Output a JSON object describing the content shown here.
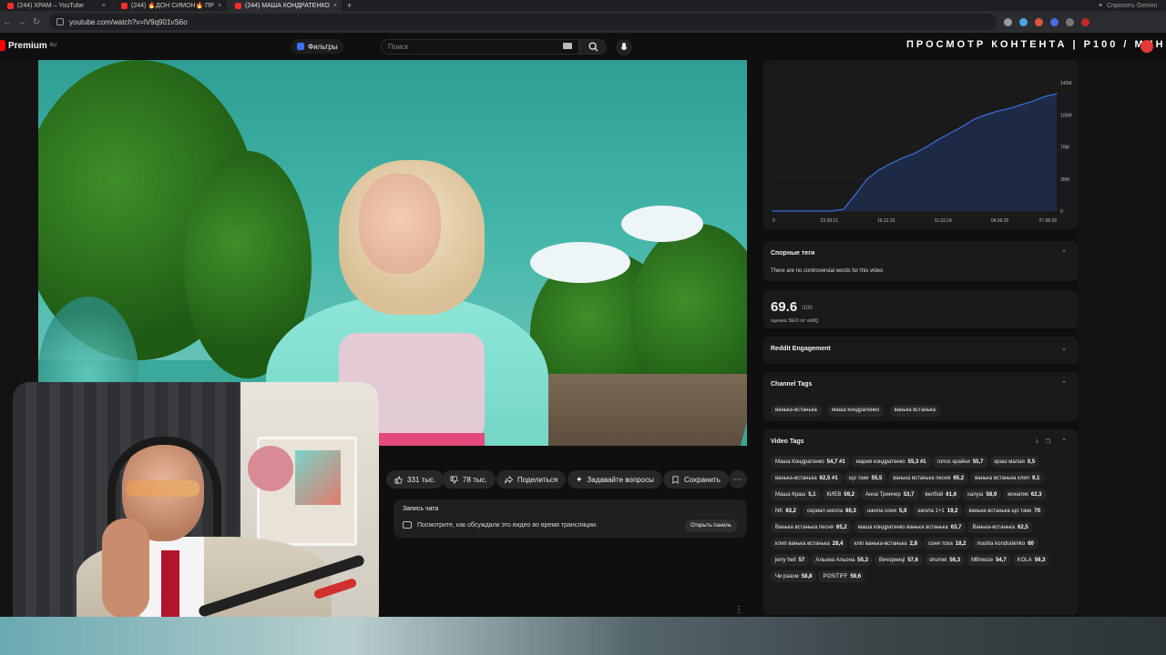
{
  "browser": {
    "tabs": [
      {
        "label": "(244) ХРАМ – YouTube"
      },
      {
        "label": "(244) 🔥ДОН СИМОН🔥 ПР"
      },
      {
        "label": "(244) МАША КОНДРАТЕНКО"
      }
    ],
    "new_tab": "+",
    "gemini": "Спросить Gemini",
    "url": "youtube.com/watch?v=lV9q901vS6o"
  },
  "header": {
    "logo": "Premium",
    "logo_sup": "RU",
    "filters": "Фильтры",
    "search_placeholder": "Поиск",
    "overlay": "ПРОСМОТР КОНТЕНТА | P100 / МИН"
  },
  "actions": {
    "likes": "331 тыс.",
    "dislikes": "78 тыс.",
    "share": "Поделиться",
    "ask": "Задавайте вопросы",
    "save": "Сохранить",
    "more": "⋯"
  },
  "chat": {
    "title": "Запись чата",
    "desc": "Посмотрите, как обсуждали это видео во время трансляции.",
    "open": "Открыть панель"
  },
  "chart_data": {
    "type": "area",
    "x": [
      "23.09.21",
      "16.12.22",
      "11.03.24",
      "04.06.25",
      "27.08.26"
    ],
    "x_ticks_labels": [
      "0",
      "23.09.21",
      "16.12.22",
      "11.03.24",
      "04.06.25",
      "27.08.26"
    ],
    "y_ticks": [
      "0",
      "35M",
      "70M",
      "105M",
      "140M"
    ],
    "ylim": [
      0,
      140
    ],
    "series": [
      {
        "values": [
          0,
          0,
          0,
          0,
          0,
          0,
          2,
          18,
          35,
          45,
          52,
          58,
          63,
          70,
          78,
          85,
          92,
          100,
          105,
          109,
          112,
          116,
          120,
          125,
          128
        ]
      }
    ],
    "color": "#3b6fe0"
  },
  "cards": {
    "controversial_title": "Спорные теги",
    "controversial_note": "There are no controversial words for this video",
    "seo_score": "69.6",
    "seo_max": "/100",
    "seo_label": "оценка SEO от vidIQ",
    "reddit_title": "Reddit Engagement",
    "channel_tags_title": "Channel Tags",
    "channel_tags": [
      "ванька-встанька",
      "маша кондратенко",
      "ванька встанька"
    ],
    "video_tags_title": "Video Tags",
    "video_tags": [
      {
        "name": "Маша Кондратенко",
        "score": "54,7 #1"
      },
      {
        "name": "мария кондратенко",
        "score": "55,3 #1"
      },
      {
        "name": "голос крайни",
        "score": "55,7"
      },
      {
        "name": "краш малая",
        "score": "0,5"
      },
      {
        "name": "ванька-встанька",
        "score": "62,5 #1"
      },
      {
        "name": "що таке",
        "score": "55,5"
      },
      {
        "name": "ванька встанька песня",
        "score": "65,2"
      },
      {
        "name": "ванька встанька клип",
        "score": "9,1"
      },
      {
        "name": "Маша Краш",
        "score": "5,1"
      },
      {
        "name": "КИЕВ",
        "score": "59,2"
      },
      {
        "name": "Анна Тринчер",
        "score": "53,7"
      },
      {
        "name": "велбой",
        "score": "61,6"
      },
      {
        "name": "калуш",
        "score": "58,9"
      },
      {
        "name": "монатик",
        "score": "62,3"
      },
      {
        "name": "NK",
        "score": "63,2"
      },
      {
        "name": "сериал школа",
        "score": "60,3"
      },
      {
        "name": "школа соня",
        "score": "5,9"
      },
      {
        "name": "школа 1+1",
        "score": "19,2"
      },
      {
        "name": "ванька встанька що таке",
        "score": "70"
      },
      {
        "name": "Ванька встанька песня",
        "score": "65,2"
      },
      {
        "name": "маша кондратенко ванька встанька",
        "score": "63,7"
      },
      {
        "name": "Ванька-встанька",
        "score": "62,5"
      },
      {
        "name": "клип ванька встанька",
        "score": "28,4"
      },
      {
        "name": "клiп ванька-встанька",
        "score": "2,8"
      },
      {
        "name": "соня тоха",
        "score": "18,2"
      },
      {
        "name": "masha kondratenko",
        "score": "60"
      },
      {
        "name": "jerry heil",
        "score": "57"
      },
      {
        "name": "Альона Альона",
        "score": "55,3"
      },
      {
        "name": "Вечорниці",
        "score": "57,6"
      },
      {
        "name": "shumei",
        "score": "56,3"
      },
      {
        "name": "MBreeze",
        "score": "54,7"
      },
      {
        "name": "KOLA",
        "score": "56,3"
      },
      {
        "name": "Чи разом",
        "score": "58,8"
      },
      {
        "name": "POSITIFF",
        "score": "59,6"
      }
    ]
  }
}
